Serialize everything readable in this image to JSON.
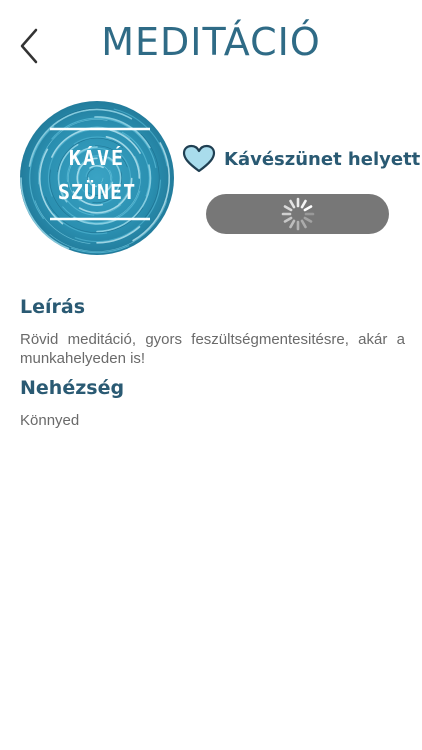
{
  "header": {
    "title": "MEDITÁCIÓ",
    "back_icon": "chevron-left-icon"
  },
  "cover": {
    "line1": "KÁVÉ",
    "line2": "SZÜNET",
    "background_color": "#2a8fb0"
  },
  "track": {
    "title": "Kávészünet helyett",
    "favorite_icon": "heart-outline-icon",
    "favorite_fill": "#a9dcec"
  },
  "player": {
    "state": "loading",
    "spinner_icon": "spinner-icon",
    "bar_color": "#777777"
  },
  "description": {
    "heading": "Leírás",
    "text": "Rövid meditáció, gyors feszültségmentesitésre, akár a munkahelyeden is!"
  },
  "difficulty": {
    "heading": "Nehézség",
    "value": "Könnyed"
  },
  "colors": {
    "accent": "#2f6b86",
    "heading": "#2a5a73",
    "body_text": "#6a6a6a"
  }
}
